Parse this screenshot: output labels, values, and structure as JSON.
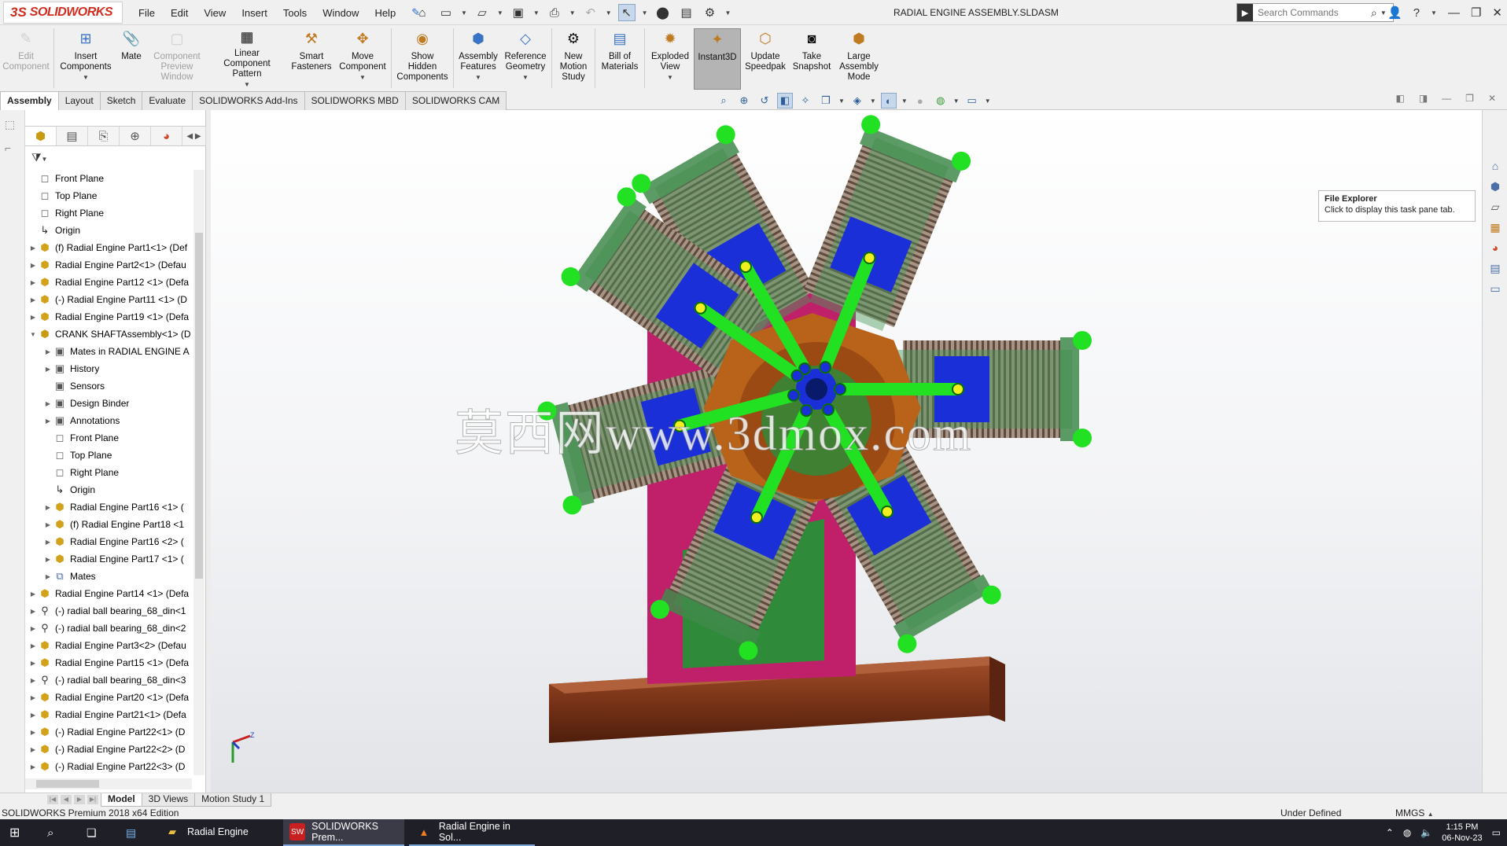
{
  "app": {
    "logo_ds": "3S",
    "logo_name": "SOLIDWORKS",
    "document_title": "RADIAL ENGINE ASSEMBLY.SLDASM"
  },
  "menu": [
    "File",
    "Edit",
    "View",
    "Insert",
    "Tools",
    "Window",
    "Help"
  ],
  "search": {
    "placeholder": "Search Commands"
  },
  "ribbon": [
    {
      "label": "Edit Component",
      "icon": "edit-component-icon",
      "state": "disabled"
    },
    {
      "label": "Insert Components",
      "icon": "insert-components-icon",
      "state": "normal"
    },
    {
      "label": "Mate",
      "icon": "mate-icon",
      "state": "normal"
    },
    {
      "label": "Component Preview Window",
      "icon": "component-preview-icon",
      "state": "disabled"
    },
    {
      "label": "Linear Component Pattern",
      "icon": "linear-pattern-icon",
      "state": "normal"
    },
    {
      "label": "Smart Fasteners",
      "icon": "smart-fasteners-icon",
      "state": "normal"
    },
    {
      "label": "Move Component",
      "icon": "move-component-icon",
      "state": "normal"
    },
    {
      "label": "Show Hidden Components",
      "icon": "show-hidden-icon",
      "state": "normal"
    },
    {
      "label": "Assembly Features",
      "icon": "assembly-features-icon",
      "state": "normal"
    },
    {
      "label": "Reference Geometry",
      "icon": "reference-geometry-icon",
      "state": "normal"
    },
    {
      "label": "New Motion Study",
      "icon": "motion-study-icon",
      "state": "normal"
    },
    {
      "label": "Bill of Materials",
      "icon": "bill-of-materials-icon",
      "state": "normal"
    },
    {
      "label": "Exploded View",
      "icon": "exploded-view-icon",
      "state": "normal"
    },
    {
      "label": "Instant3D",
      "icon": "instant3d-icon",
      "state": "pressed"
    },
    {
      "label": "Update Speedpak",
      "icon": "speedpak-icon",
      "state": "normal"
    },
    {
      "label": "Take Snapshot",
      "icon": "snapshot-icon",
      "state": "normal"
    },
    {
      "label": "Large Assembly Mode",
      "icon": "large-assembly-icon",
      "state": "normal"
    }
  ],
  "command_tabs": [
    {
      "label": "Assembly",
      "active": true
    },
    {
      "label": "Layout",
      "active": false
    },
    {
      "label": "Sketch",
      "active": false
    },
    {
      "label": "Evaluate",
      "active": false
    },
    {
      "label": "SOLIDWORKS Add-Ins",
      "active": false
    },
    {
      "label": "SOLIDWORKS MBD",
      "active": false
    },
    {
      "label": "SOLIDWORKS CAM",
      "active": false
    }
  ],
  "tree": [
    {
      "label": "Front Plane",
      "level": 1,
      "icon": "plane",
      "expand": ""
    },
    {
      "label": "Top Plane",
      "level": 1,
      "icon": "plane",
      "expand": ""
    },
    {
      "label": "Right Plane",
      "level": 1,
      "icon": "plane",
      "expand": ""
    },
    {
      "label": "Origin",
      "level": 1,
      "icon": "origin",
      "expand": ""
    },
    {
      "label": "(f) Radial Engine Part1<1> (Def",
      "level": 1,
      "icon": "part",
      "expand": "collapsed"
    },
    {
      "label": "Radial Engine Part2<1> (Defau",
      "level": 1,
      "icon": "part",
      "expand": "collapsed"
    },
    {
      "label": "Radial Engine Part12 <1> (Defa",
      "level": 1,
      "icon": "part",
      "expand": "collapsed"
    },
    {
      "label": "(-) Radial Engine Part11 <1> (D",
      "level": 1,
      "icon": "part",
      "expand": "collapsed"
    },
    {
      "label": "Radial Engine Part19 <1> (Defa",
      "level": 1,
      "icon": "part",
      "expand": "collapsed"
    },
    {
      "label": "CRANK SHAFTAssembly<1> (D",
      "level": 1,
      "icon": "assembly",
      "expand": "expanded"
    },
    {
      "label": "Mates in RADIAL ENGINE A",
      "level": 2,
      "icon": "folder",
      "expand": "collapsed"
    },
    {
      "label": "History",
      "level": 2,
      "icon": "folder",
      "expand": "collapsed"
    },
    {
      "label": "Sensors",
      "level": 2,
      "icon": "folder",
      "expand": ""
    },
    {
      "label": "Design Binder",
      "level": 2,
      "icon": "folder",
      "expand": "collapsed"
    },
    {
      "label": "Annotations",
      "level": 2,
      "icon": "folder",
      "expand": "collapsed"
    },
    {
      "label": "Front Plane",
      "level": 2,
      "icon": "plane",
      "expand": ""
    },
    {
      "label": "Top Plane",
      "level": 2,
      "icon": "plane",
      "expand": ""
    },
    {
      "label": "Right Plane",
      "level": 2,
      "icon": "plane",
      "expand": ""
    },
    {
      "label": "Origin",
      "level": 2,
      "icon": "origin",
      "expand": ""
    },
    {
      "label": "Radial Engine Part16 <1> (",
      "level": 2,
      "icon": "part",
      "expand": "collapsed"
    },
    {
      "label": "(f) Radial Engine Part18 <1",
      "level": 2,
      "icon": "part",
      "expand": "collapsed"
    },
    {
      "label": "Radial Engine Part16 <2> (",
      "level": 2,
      "icon": "part",
      "expand": "collapsed"
    },
    {
      "label": "Radial Engine Part17 <1> (",
      "level": 2,
      "icon": "part",
      "expand": "collapsed"
    },
    {
      "label": "Mates",
      "level": 2,
      "icon": "mates",
      "expand": "collapsed"
    },
    {
      "label": "Radial Engine Part14 <1> (Defa",
      "level": 1,
      "icon": "part",
      "expand": "collapsed"
    },
    {
      "label": "(-) radial ball bearing_68_din<1",
      "level": 1,
      "icon": "bearing",
      "expand": "collapsed"
    },
    {
      "label": "(-) radial ball bearing_68_din<2",
      "level": 1,
      "icon": "bearing",
      "expand": "collapsed"
    },
    {
      "label": "Radial Engine Part3<2> (Defau",
      "level": 1,
      "icon": "part",
      "expand": "collapsed"
    },
    {
      "label": "Radial Engine Part15 <1> (Defa",
      "level": 1,
      "icon": "part",
      "expand": "collapsed"
    },
    {
      "label": "(-) radial ball bearing_68_din<3",
      "level": 1,
      "icon": "bearing",
      "expand": "collapsed"
    },
    {
      "label": "Radial Engine Part20 <1> (Defa",
      "level": 1,
      "icon": "part",
      "expand": "collapsed"
    },
    {
      "label": "Radial Engine Part21<1> (Defa",
      "level": 1,
      "icon": "part",
      "expand": "collapsed"
    },
    {
      "label": "(-) Radial Engine Part22<1> (D",
      "level": 1,
      "icon": "part",
      "expand": "collapsed"
    },
    {
      "label": "(-) Radial Engine Part22<2> (D",
      "level": 1,
      "icon": "part",
      "expand": "collapsed"
    },
    {
      "label": "(-) Radial Engine Part22<3> (D",
      "level": 1,
      "icon": "part",
      "expand": "collapsed"
    }
  ],
  "viewport": {
    "watermark": "莫西网www.3dmox.com",
    "triad_label": "Z"
  },
  "tooltip": {
    "title": "File Explorer",
    "text": "Click to display this task pane tab."
  },
  "bottom_tabs": [
    {
      "label": "Model",
      "active": true
    },
    {
      "label": "3D Views",
      "active": false
    },
    {
      "label": "Motion Study 1",
      "active": false
    }
  ],
  "status": {
    "edition": "SOLIDWORKS Premium 2018 x64 Edition",
    "definition": "Under Defined",
    "units": "MMGS"
  },
  "taskbar": {
    "items": [
      {
        "label": "Radial Engine",
        "icon": "folder-icon",
        "active": false
      },
      {
        "label": "SOLIDWORKS Prem...",
        "icon": "solidworks-icon",
        "active": true
      },
      {
        "label": "Radial Engine in Sol...",
        "icon": "vlc-icon",
        "active": false
      }
    ],
    "clock_time": "1:15 PM",
    "clock_date": "06-Nov-23"
  },
  "colors": {
    "brand": "#d12d1f",
    "connecting_rod": "#22e022",
    "piston": "#1a2fd8",
    "crankcase": "#b8621a",
    "base": "#8a3a18",
    "mount": "#c0206a"
  }
}
